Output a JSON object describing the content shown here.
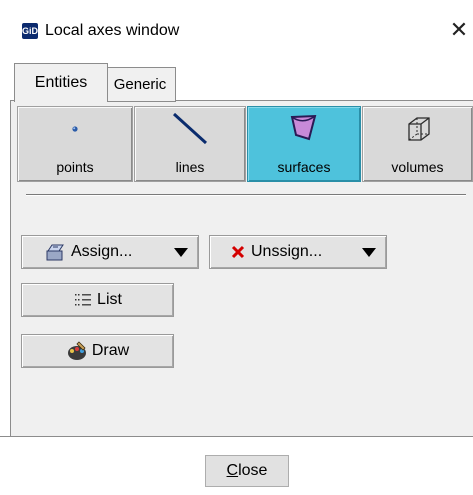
{
  "window": {
    "icon_text": "GiD",
    "title": "Local axes window",
    "close_glyph": "✕"
  },
  "tabs": [
    {
      "label": "Entities",
      "active": true
    },
    {
      "label": "Generic",
      "active": false
    }
  ],
  "entity_buttons": [
    {
      "label": "points",
      "icon": "point-icon",
      "selected": false
    },
    {
      "label": "lines",
      "icon": "line-icon",
      "selected": false
    },
    {
      "label": "surfaces",
      "icon": "surface-icon",
      "selected": true
    },
    {
      "label": "volumes",
      "icon": "volume-icon",
      "selected": false
    }
  ],
  "actions": {
    "assign": {
      "label": "Assign...",
      "icon": "assign-icon"
    },
    "unassign": {
      "label": "Unssign...",
      "icon": "unassign-x-icon"
    },
    "list": {
      "label": "List",
      "icon": "list-icon"
    },
    "draw": {
      "label": "Draw",
      "icon": "draw-icon"
    }
  },
  "footer": {
    "close_underlined": "C",
    "close_rest": "lose"
  },
  "colors": {
    "selected_bg": "#4ec2dc",
    "unassign_x": "#d40000",
    "title_icon_bg": "#0b2a6e"
  }
}
